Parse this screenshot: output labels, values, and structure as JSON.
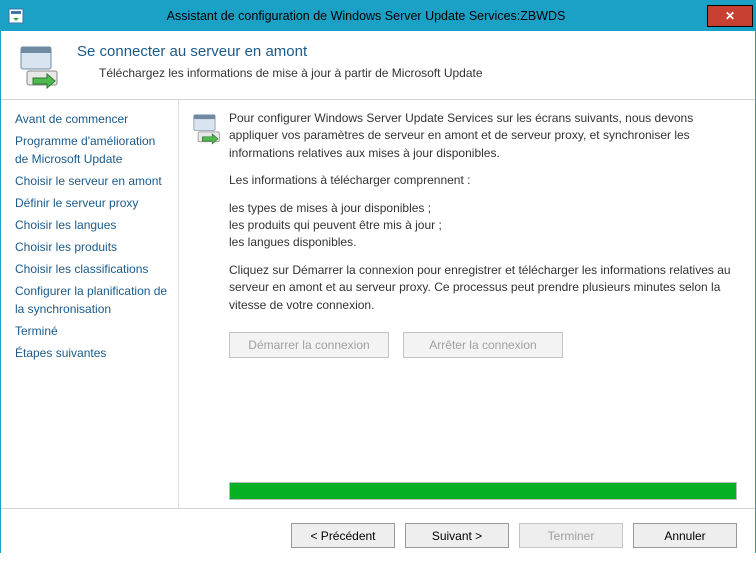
{
  "titlebar": {
    "title": "Assistant de configuration de Windows Server Update Services:ZBWDS",
    "close_label": "✕"
  },
  "header": {
    "title": "Se connecter au serveur en amont",
    "subtitle": "Téléchargez les informations de mise à jour à partir de Microsoft Update"
  },
  "sidebar": {
    "items": [
      {
        "label": "Avant de commencer"
      },
      {
        "label": "Programme d'amélioration de Microsoft Update"
      },
      {
        "label": "Choisir le serveur en amont"
      },
      {
        "label": "Définir le serveur proxy"
      },
      {
        "label": "Choisir les langues"
      },
      {
        "label": "Choisir les produits"
      },
      {
        "label": "Choisir les classifications"
      },
      {
        "label": "Configurer la planification de la synchronisation"
      },
      {
        "label": "Terminé"
      },
      {
        "label": "Étapes suivantes"
      }
    ]
  },
  "content": {
    "para1": "Pour configurer Windows Server Update Services sur les écrans suivants, nous devons appliquer vos paramètres de serveur en amont et de serveur proxy, et synchroniser les informations relatives aux mises à jour disponibles.",
    "para2": "Les informations à télécharger comprennent :",
    "bullets": [
      "les types de mises à jour disponibles ;",
      "les produits qui peuvent être mis à jour ;",
      "les langues disponibles."
    ],
    "para3": "Cliquez sur Démarrer la connexion pour enregistrer et télécharger les informations relatives au serveur en amont et au serveur proxy. Ce processus peut prendre plusieurs minutes selon la vitesse de votre connexion.",
    "start_button": "Démarrer la connexion",
    "stop_button": "Arrêter la connexion"
  },
  "progress": {
    "percent": 100
  },
  "footer": {
    "back": "< Précédent",
    "next": "Suivant >",
    "finish": "Terminer",
    "cancel": "Annuler"
  },
  "colors": {
    "accent": "#1ba1c5",
    "link": "#1a5a8a",
    "progress_fill": "#06b025",
    "close_bg": "#c84031"
  }
}
